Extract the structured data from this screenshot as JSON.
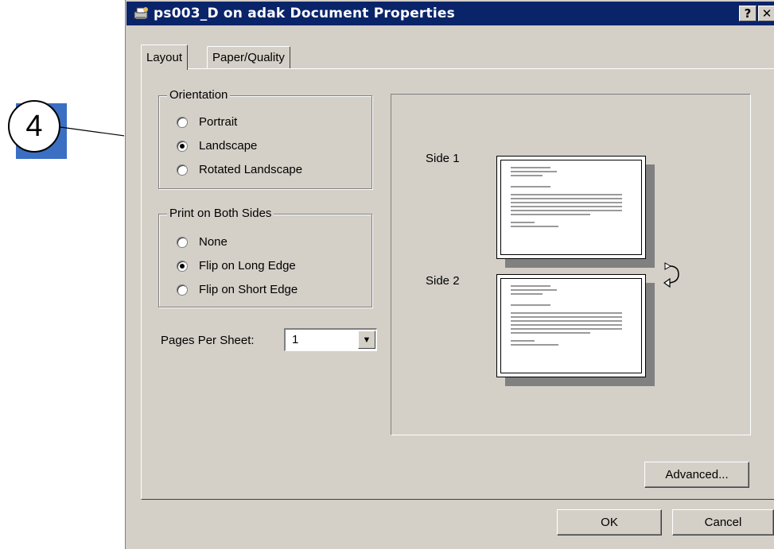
{
  "callout": {
    "number": "4"
  },
  "window": {
    "title": "ps003_D on adak Document Properties",
    "help_label": "?",
    "close_label": "✕"
  },
  "tabs": [
    {
      "label": "Layout",
      "active": true
    },
    {
      "label": "Paper/Quality",
      "active": false
    }
  ],
  "orientation": {
    "label": "Orientation",
    "options": [
      "Portrait",
      "Landscape",
      "Rotated Landscape"
    ],
    "selected": "Landscape"
  },
  "both_sides": {
    "label": "Print on Both Sides",
    "options": [
      "None",
      "Flip on Long Edge",
      "Flip on Short Edge"
    ],
    "selected": "Flip on Long Edge"
  },
  "pages_per_sheet": {
    "label": "Pages Per Sheet:",
    "value": "1"
  },
  "preview": {
    "side1": "Side 1",
    "side2": "Side 2"
  },
  "buttons": {
    "advanced": "Advanced...",
    "ok": "OK",
    "cancel": "Cancel"
  },
  "colors": {
    "titlebar": "#0a246a",
    "dialog_bg": "#d4d0c8",
    "callout_blue": "#3a6fc4"
  }
}
